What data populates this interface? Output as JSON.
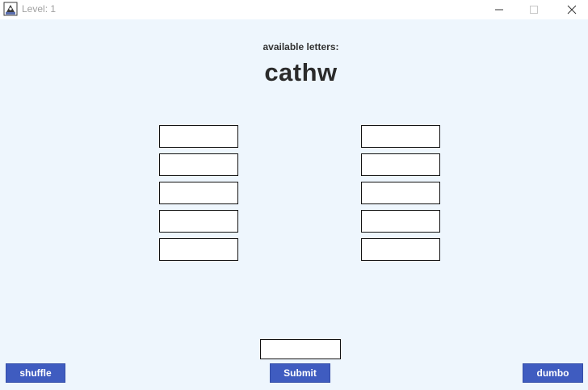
{
  "window": {
    "title": "Level: 1"
  },
  "icons": {
    "app": "java-app-icon",
    "minimize": "minimize-icon",
    "maximize": "maximize-icon",
    "close": "close-icon"
  },
  "main": {
    "available_label": "available letters:",
    "letters": "cathw",
    "left_slots": [
      "",
      "",
      "",
      "",
      ""
    ],
    "right_slots": [
      "",
      "",
      "",
      "",
      ""
    ],
    "answer_value": ""
  },
  "buttons": {
    "shuffle_label": "shuffle",
    "submit_label": "Submit",
    "dumbo_label": "dumbo"
  },
  "colors": {
    "background": "#eef6fd",
    "button": "#3f5cc0",
    "button_text": "#ffffff"
  }
}
